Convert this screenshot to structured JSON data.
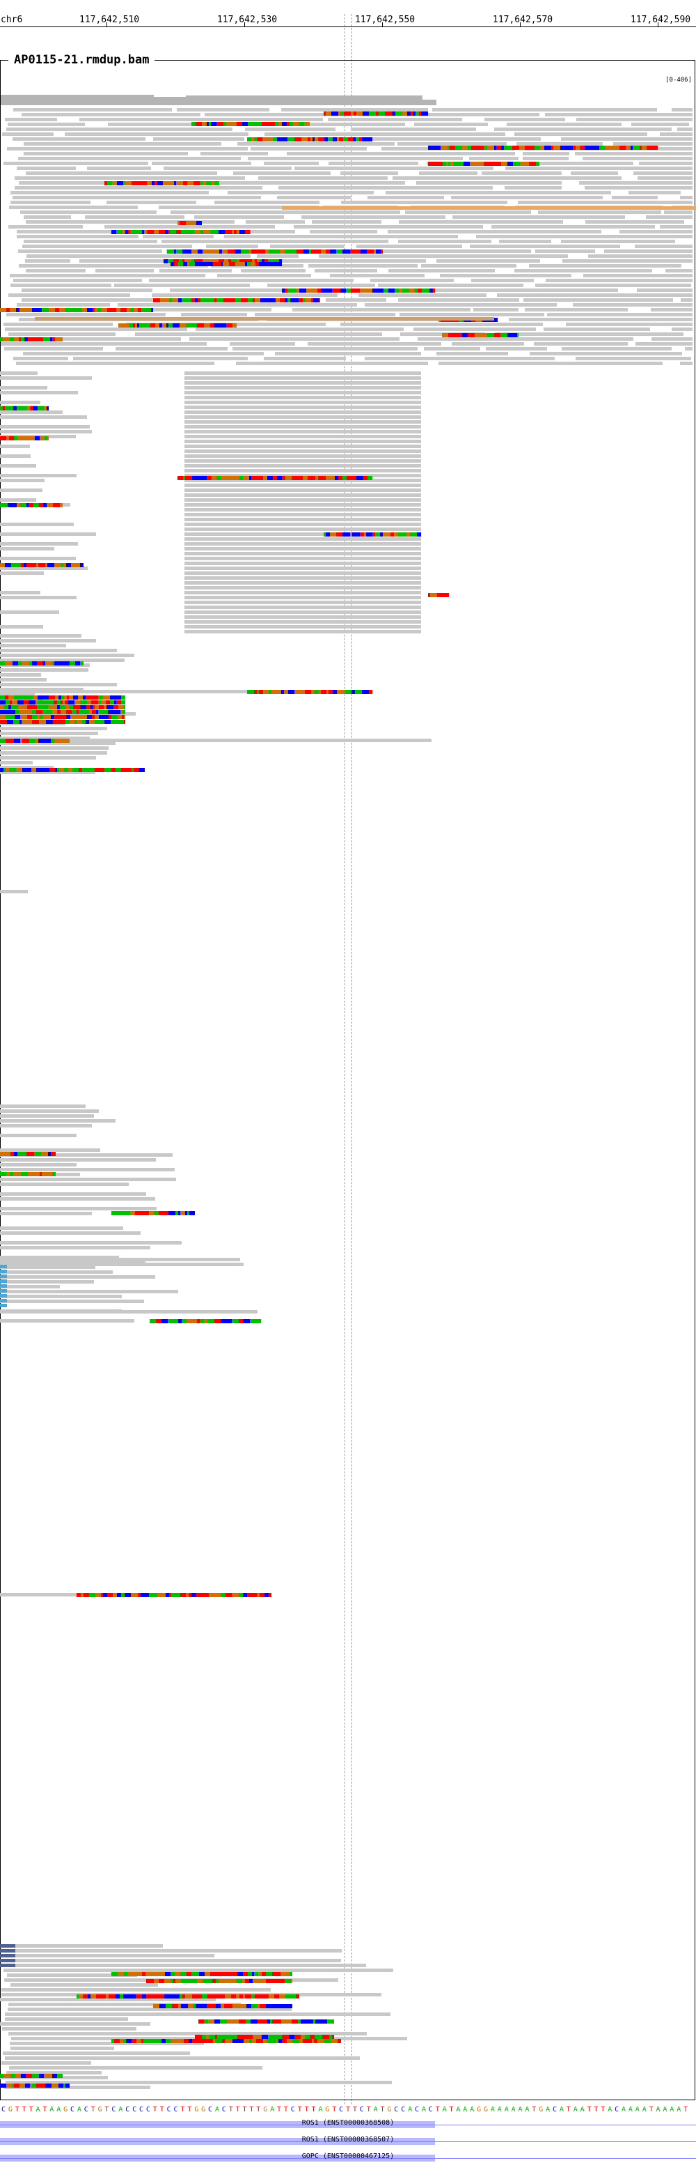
{
  "header": {
    "chromosome": "chr6",
    "positions": [
      "117,642,510",
      "117,642,530",
      "117,642,550",
      "117,642,570",
      "117,642,590"
    ]
  },
  "track": {
    "title": "AP0115-21.rmdup.bam",
    "scale": "[0-406]"
  },
  "sequence": "CGTTTATAAGCACTGTCACCCCTTCCTTGGCACTTTTTGATTCTTTAGTCTTCTATGCCACACTATAAAGGAAAAAATGACATAATTTACAAAATAAAAT",
  "genes": [
    {
      "name": "ROS1 (ENST00000368508)"
    },
    {
      "name": "ROS1 (ENST00000368507)"
    },
    {
      "name": "GOPC (ENST00000467125)"
    }
  ],
  "colors": {
    "A": "#00c000",
    "C": "#0000ff",
    "G": "#d17105",
    "T": "#ff0000",
    "read": "#c8c8c8",
    "gene": "#8080ff"
  }
}
